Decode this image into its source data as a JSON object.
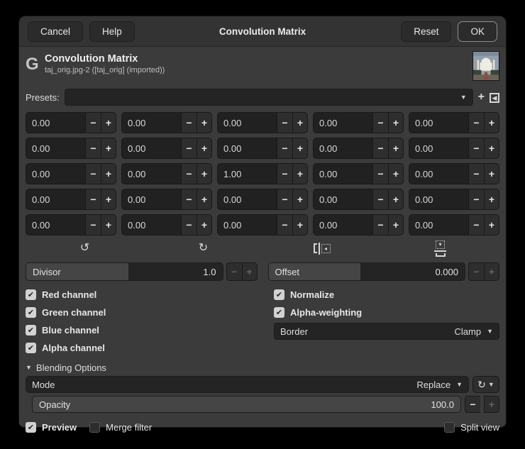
{
  "titlebar": {
    "cancel_label": "Cancel",
    "help_label": "Help",
    "title": "Convolution Matrix",
    "reset_label": "Reset",
    "ok_label": "OK"
  },
  "header": {
    "logo_glyph": "G",
    "title": "Convolution Matrix",
    "subtitle": "taj_orig.jpg-2 ([taj_orig] (imported))"
  },
  "presets": {
    "label": "Presets:",
    "selected_value": ""
  },
  "icons": {
    "dropdown": "▼",
    "plus": "+",
    "minus": "−",
    "check": "✔",
    "preset_add": "+",
    "preset_menu_triangle": "◀",
    "rotate_ccw": "↺",
    "rotate_cw": "↻",
    "flip_h_triangle": "◂",
    "flip_v_triangle": "▾",
    "reset_circular": "↻",
    "expander_triangle": "▼"
  },
  "matrix": {
    "values": [
      [
        "0.00",
        "0.00",
        "0.00",
        "0.00",
        "0.00"
      ],
      [
        "0.00",
        "0.00",
        "0.00",
        "0.00",
        "0.00"
      ],
      [
        "0.00",
        "0.00",
        "1.00",
        "0.00",
        "0.00"
      ],
      [
        "0.00",
        "0.00",
        "0.00",
        "0.00",
        "0.00"
      ],
      [
        "0.00",
        "0.00",
        "0.00",
        "0.00",
        "0.00"
      ]
    ]
  },
  "divisor": {
    "label": "Divisor",
    "value": "1.0"
  },
  "offset": {
    "label": "Offset",
    "value": "0.000"
  },
  "channels": {
    "red": "Red channel",
    "green": "Green channel",
    "blue": "Blue channel",
    "alpha": "Alpha channel",
    "normalize": "Normalize",
    "alpha_weighting": "Alpha-weighting"
  },
  "border": {
    "label": "Border",
    "value": "Clamp"
  },
  "blending": {
    "section_label": "Blending Options",
    "mode_label": "Mode",
    "mode_value": "Replace",
    "opacity_label": "Opacity",
    "opacity_value": "100.0"
  },
  "footer": {
    "preview_label": "Preview",
    "merge_label": "Merge filter",
    "split_label": "Split view"
  },
  "colors": {
    "window_bg": "#3b3b3b",
    "titlebar_bg": "#333333",
    "entry_bg": "#242424",
    "fill_bg": "#454545",
    "text": "#dcdcdc",
    "ok_border": "#8f8f8f"
  }
}
